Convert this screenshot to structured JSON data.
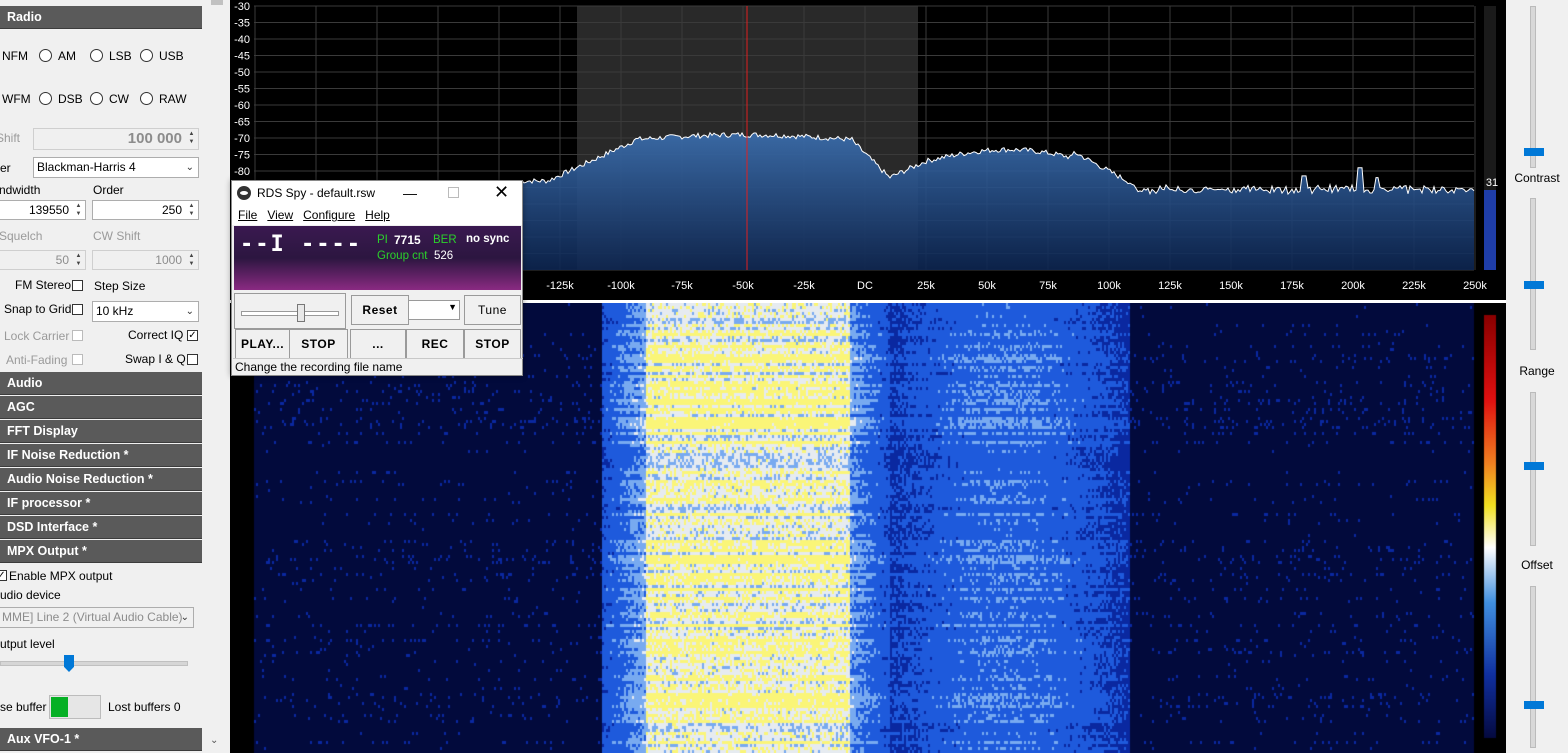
{
  "sdr": {
    "radio_header": "Radio",
    "modes_row1": [
      "NFM",
      "AM",
      "LSB",
      "USB"
    ],
    "modes_row2": [
      "WFM",
      "DSB",
      "CW",
      "RAW"
    ],
    "shift_label": "Shift",
    "shift_value": "100 000",
    "filter_label": "er",
    "filter_value": "Blackman-Harris 4",
    "bandwidth_label": "ndwidth",
    "order_label": "Order",
    "bandwidth_value": "139550",
    "order_value": "250",
    "squelch_label": "Squelch",
    "cwshift_label": "CW Shift",
    "squelch_value": "50",
    "cwshift_value": "1000",
    "fm_stereo": "FM Stereo",
    "step_size_label": "Step Size",
    "snap_to_grid": "Snap to Grid",
    "step_size_value": "10 kHz",
    "lock_carrier": "Lock Carrier",
    "correct_iq": "Correct IQ",
    "anti_fading": "Anti-Fading",
    "swap_iq": "Swap I & Q",
    "sections": [
      "Audio",
      "AGC",
      "FFT Display",
      "IF Noise Reduction *",
      "Audio Noise Reduction *",
      "IF processor *",
      "DSD Interface *",
      "MPX Output *"
    ],
    "mpx": {
      "enable": "Enable MPX output",
      "audio_device_label": "udio device",
      "audio_device_value": "MME] Line 2 (Virtual Audio Cable)",
      "output_level_label": "utput level",
      "buffer_label": "se buffer",
      "lost_buffers": "Lost buffers 0"
    },
    "aux_vfo": "Aux VFO-1 *"
  },
  "spectrum": {
    "db_labels": [
      "-30",
      "-35",
      "-40",
      "-45",
      "-50",
      "-55",
      "-60",
      "-65",
      "-70",
      "-75",
      "-80"
    ],
    "freq_labels": [
      "-125k",
      "-100k",
      "-75k",
      "-50k",
      "-25k",
      "DC",
      "25k",
      "50k",
      "75k",
      "100k",
      "125k",
      "150k",
      "175k",
      "200k",
      "225k",
      "250k"
    ],
    "level_readout": "31"
  },
  "right_panel": {
    "contrast": "Contrast",
    "range": "Range",
    "offset": "Offset"
  },
  "rds": {
    "title": "RDS Spy - default.rsw",
    "menu": [
      "File",
      "View",
      "Configure",
      "Help"
    ],
    "ps_display": "--I ----",
    "pi_label": "PI",
    "pi_value": "7715",
    "ber_label": "BER",
    "ber_value": "no sync",
    "group_cnt_label": "Group cnt",
    "group_cnt_value": "526",
    "buttons": {
      "reset": "Reset",
      "tune": "Tune",
      "play": "PLAY...",
      "stop1": "STOP",
      "browse": "...",
      "rec": "REC",
      "stop2": "STOP"
    },
    "status_text": "Change the recording file name"
  },
  "colors": {
    "section_header": "#5a5a5a",
    "spectrum_fill": "#1f4f8c",
    "vfo_line": "#e02020",
    "slider_thumb": "#0078d7"
  }
}
